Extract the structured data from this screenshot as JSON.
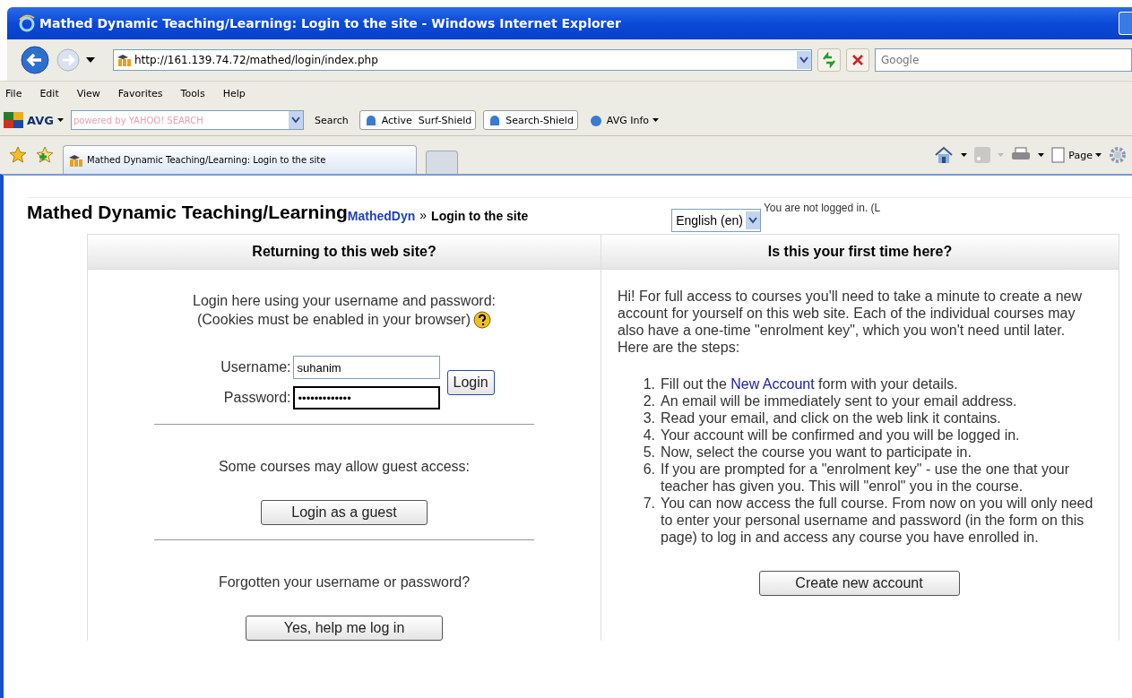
{
  "window": {
    "title": "Mathed Dynamic Teaching/Learning: Login to the site - Windows Internet Explorer"
  },
  "address_bar": {
    "url": "http://161.139.74.72/mathed/login/index.php",
    "search_placeholder": "Google"
  },
  "menu": [
    "File",
    "Edit",
    "View",
    "Favorites",
    "Tools",
    "Help"
  ],
  "avg_toolbar": {
    "brand": "AVG",
    "search_placeholder": "powered by YAHOO! SEARCH",
    "buttons": [
      {
        "kind": "plain",
        "label": "Search"
      },
      {
        "kind": "boxed",
        "label": "Active  Surf-Shield"
      },
      {
        "kind": "boxed",
        "label": "Search-Shield"
      },
      {
        "kind": "dropdown",
        "label": "AVG Info"
      }
    ]
  },
  "tabs": [
    {
      "label": "Mathed Dynamic Teaching/Learning: Login to the site",
      "selected": true
    },
    {
      "selected": false
    }
  ],
  "command_bar": {
    "page_label": "Page"
  },
  "page": {
    "site_title": "Mathed Dynamic Teaching/Learning",
    "breadcrumb": {
      "link": "MathedDyn",
      "separator": "»",
      "current": "Login to the site"
    },
    "language": "English (en)",
    "login_info": "You are not logged in. (L",
    "returning": {
      "heading": "Returning to this web site?",
      "intro": [
        "Login here using your username and password:",
        "(Cookies must be enabled in your browser)"
      ],
      "username": {
        "label": "Username:",
        "value": "suhanim"
      },
      "password": {
        "label": "Password:",
        "value": "•••••••••••••"
      },
      "login_button": "Login",
      "guest_text": "Some courses may allow guest access:",
      "guest_button": "Login as a guest",
      "forgot_text": "Forgotten your username or password?",
      "forgot_button": "Yes, help me log in"
    },
    "first_time": {
      "heading": "Is this your first time here?",
      "paragraph": "Hi! For full access to courses you'll need to take a minute to create a new account for yourself on this web site. Each of the individual courses may also have a one-time \"enrolment key\", which you won't need until later. Here are the steps:",
      "steps": [
        {
          "number": "1.",
          "text": "Fill out the ",
          "link": "New Account",
          "after": " form with your details."
        },
        {
          "number": "2.",
          "text": "An email will be immediately sent to your email address."
        },
        {
          "number": "3.",
          "text": "Read your email, and click on the web link it contains."
        },
        {
          "number": "4.",
          "text": "Your account will be confirmed and you will be logged in."
        },
        {
          "number": "5.",
          "text": "Now, select the course you want to participate in."
        },
        {
          "number": "6.",
          "text": "If you are prompted for a \"enrolment key\" - use the one that your teacher has given you. This will \"enrol\" you in the course."
        },
        {
          "number": "7.",
          "text": "You can now access the full course. From now on you will only need to enter your personal username and password (in the form on this page) to log in and access any course you have enrolled in."
        }
      ],
      "create_button": "Create new account"
    }
  }
}
